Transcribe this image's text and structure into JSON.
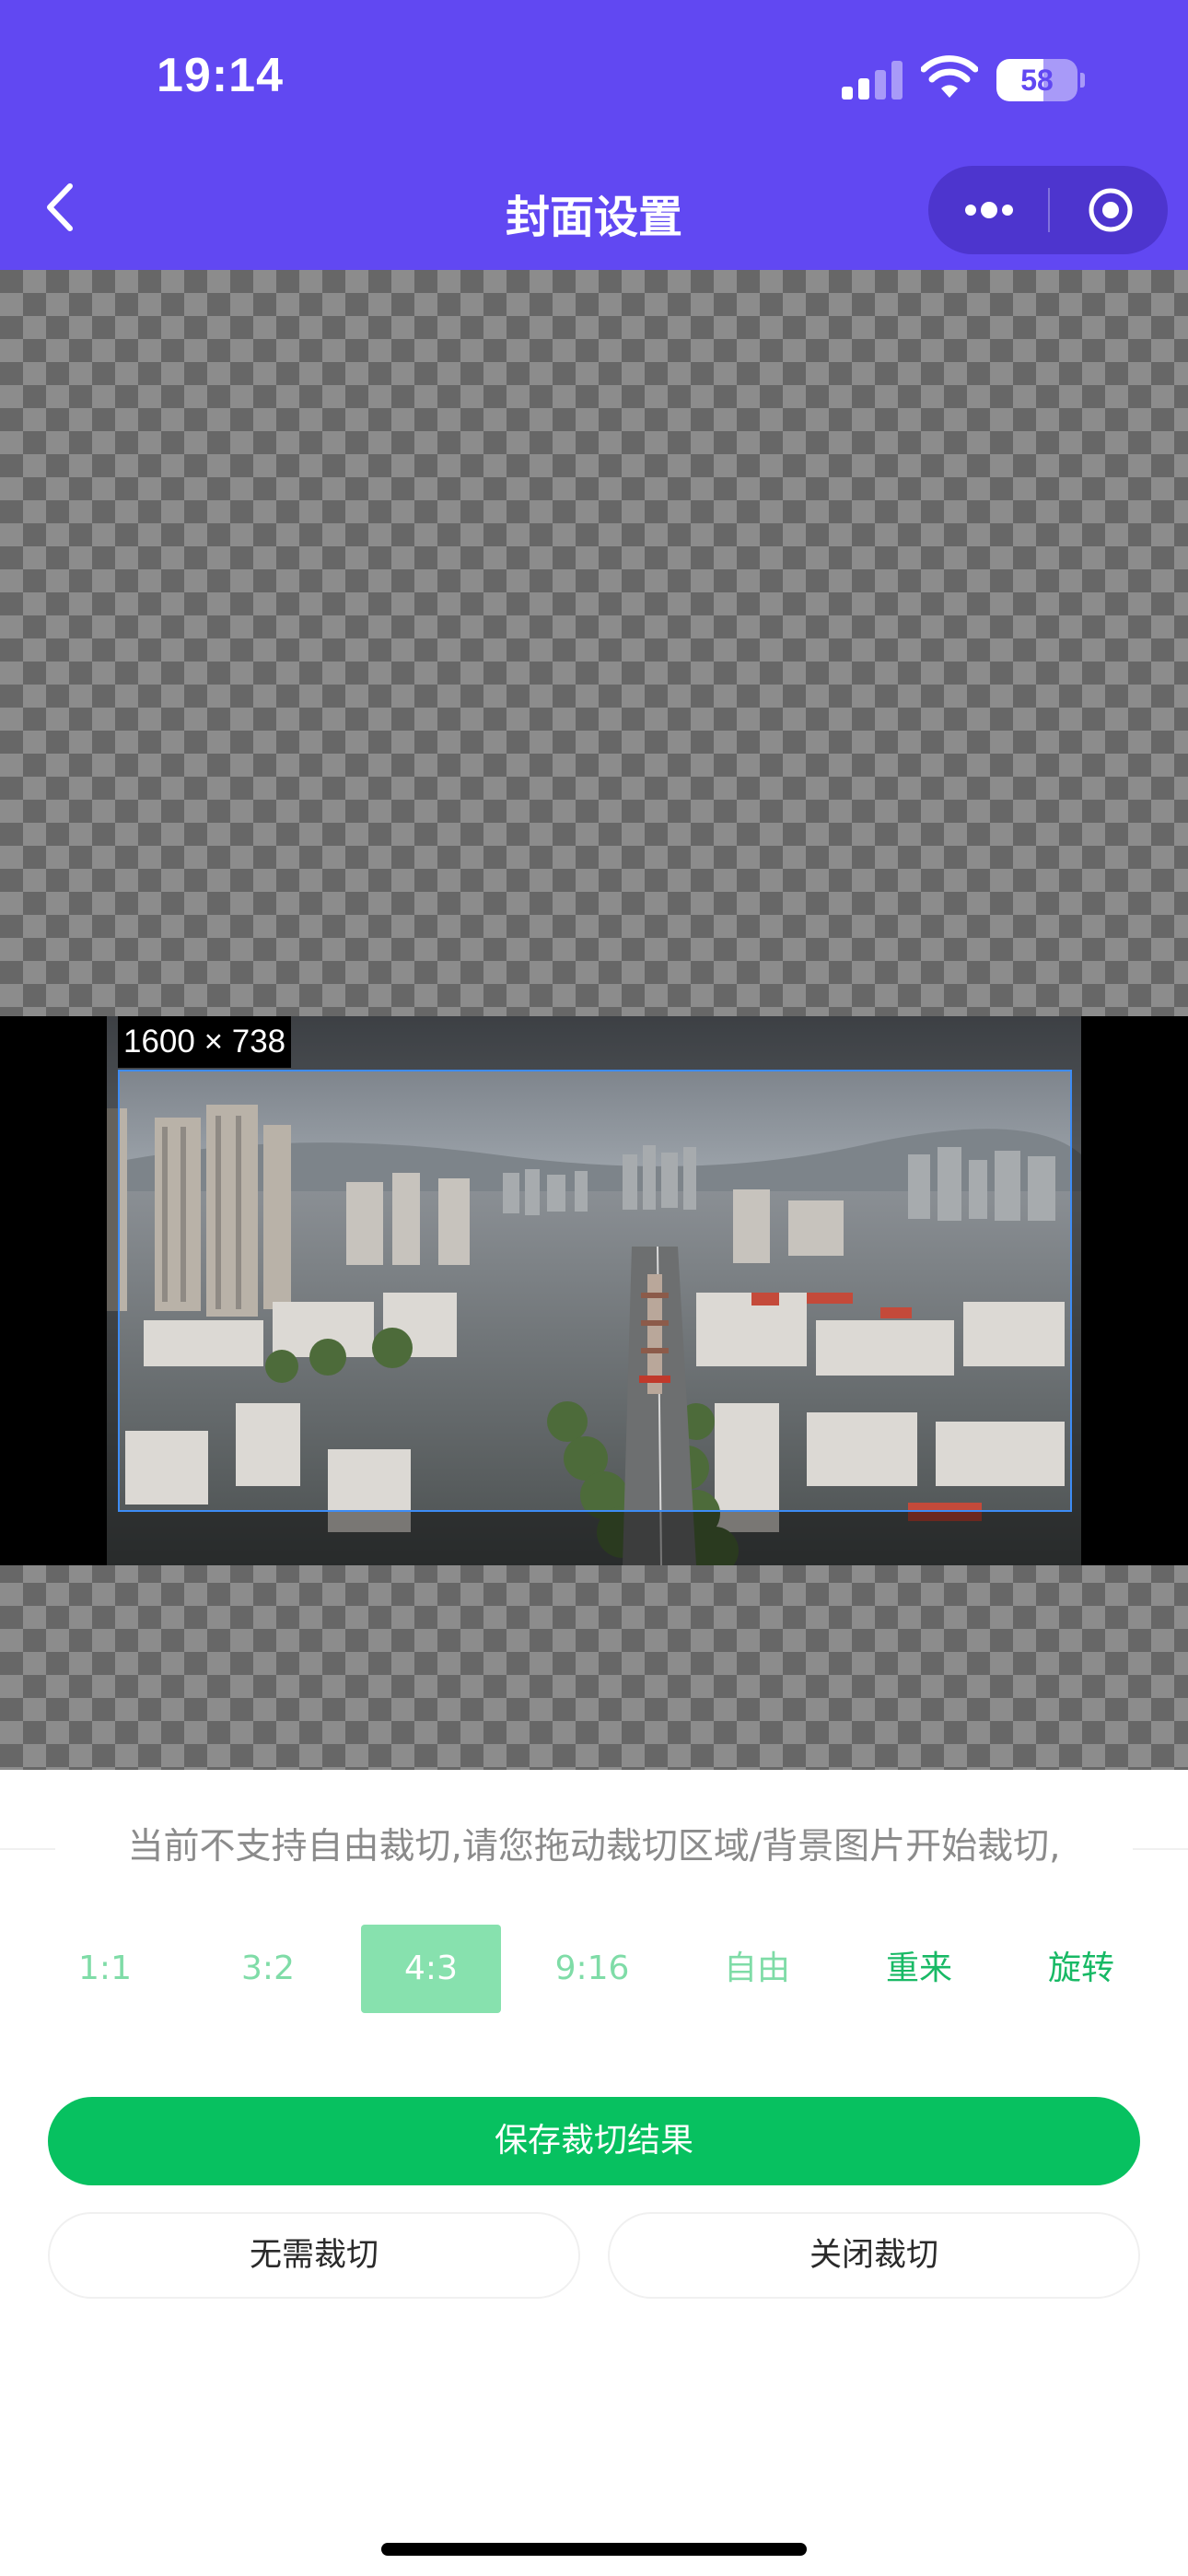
{
  "status_bar": {
    "time": "19:14",
    "battery_level": "58"
  },
  "header": {
    "title": "封面设置"
  },
  "icons": {
    "back": "chevron-left-icon",
    "more": "more-dots-icon",
    "close_miniprogram": "target-icon",
    "signal": "cellular-signal-icon",
    "wifi": "wifi-icon",
    "battery": "battery-icon"
  },
  "crop": {
    "size_label": "1600 × 738"
  },
  "hint": "当前不支持自由裁切,请您拖动裁切区域/背景图片开始裁切,",
  "ratios": [
    {
      "label": "1:1",
      "state": "normal"
    },
    {
      "label": "3:2",
      "state": "normal"
    },
    {
      "label": "4:3",
      "state": "active"
    },
    {
      "label": "9:16",
      "state": "normal"
    },
    {
      "label": "自由",
      "state": "normal"
    },
    {
      "label": "重来",
      "state": "action"
    },
    {
      "label": "旋转",
      "state": "action"
    }
  ],
  "buttons": {
    "save": "保存裁切结果",
    "no_crop": "无需裁切",
    "close_crop": "关闭裁切"
  },
  "colors": {
    "header": "#6148f2",
    "primary": "#07c160",
    "active_ratio": "#87e1ae",
    "crop_border": "#3d8cf5"
  }
}
